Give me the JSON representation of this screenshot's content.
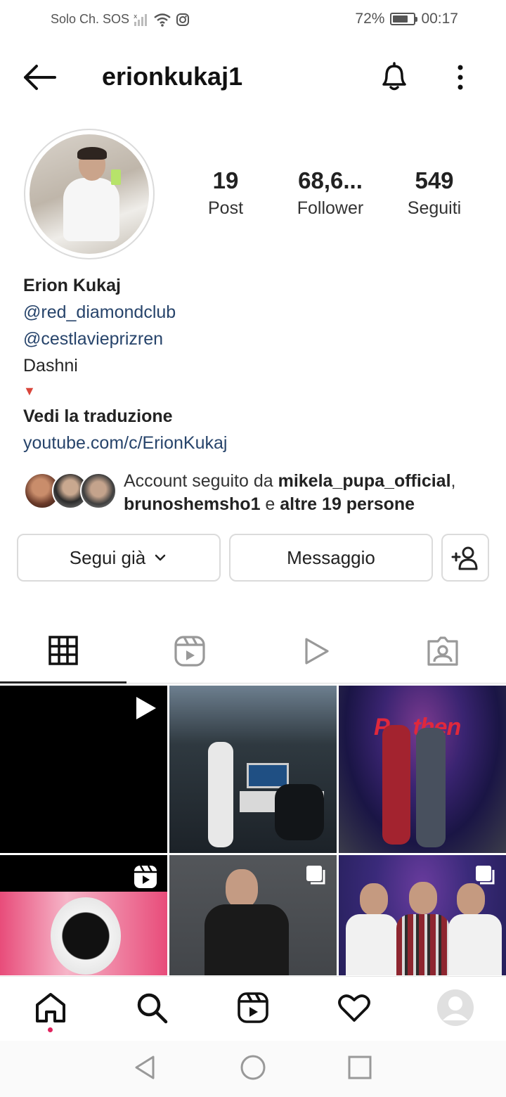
{
  "status": {
    "carrier": "Solo Ch. SOS",
    "battery": "72%",
    "battery_level": 0.72,
    "time": "00:17"
  },
  "header": {
    "username": "erionkukaj1"
  },
  "stats": [
    {
      "value": "19",
      "label": "Post"
    },
    {
      "value": "68,6...",
      "label": "Follower"
    },
    {
      "value": "549",
      "label": "Seguiti"
    }
  ],
  "bio": {
    "name": "Erion Kukaj",
    "mention1": "@red_diamondclub",
    "mention2": "@cestlavieprizren",
    "text": "Dashni",
    "triangle": "▼",
    "translate": "Vedi la traduzione",
    "website": "youtube.com/c/ErionKukaj"
  },
  "followed_by": {
    "prefix": "Account seguito da ",
    "user1": "mikela_pupa_official",
    "comma": ",",
    "user2": "brunoshemsho1",
    "connector": " e ",
    "others": "altre 19 persone"
  },
  "actions": {
    "following": "Segui già",
    "message": "Messaggio"
  },
  "tabs": [
    "grid-icon",
    "reels-icon",
    "videos-icon",
    "tagged-icon"
  ],
  "icons": {
    "back": "arrow-left-icon",
    "bell": "bell-icon",
    "more": "more-vertical-icon",
    "add_person": "add-person-icon"
  },
  "colors": {
    "link": "#27446b",
    "accent_dot": "#e0245e",
    "triangle": "#d9453b"
  }
}
